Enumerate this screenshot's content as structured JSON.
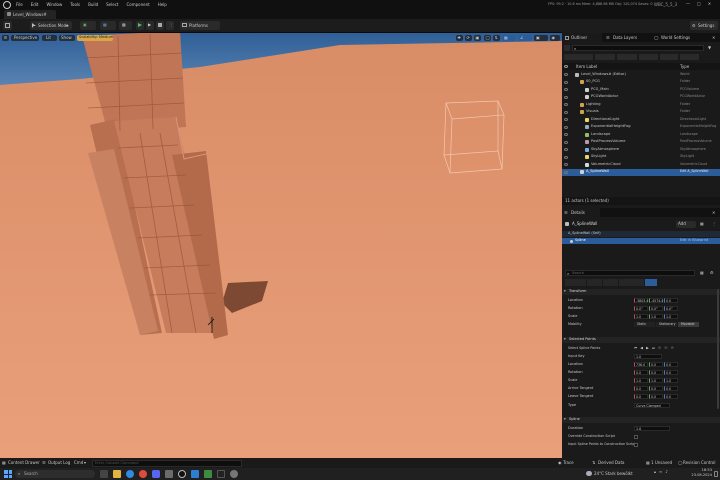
{
  "menubar": {
    "items": [
      "File",
      "Edit",
      "Window",
      "Tools",
      "Build",
      "Select",
      "Component",
      "Help"
    ],
    "stats": "FPS: 99.2 · 10.6 ms   Mem: 4,888.98 MB   Obj: 120,074   Saves: 0",
    "project": "WBC_5_5_3"
  },
  "tab": {
    "label": "Level_Windows#"
  },
  "toolbar": {
    "mode_label": "Selection Mode",
    "platforms_label": "Platforms",
    "settings_label": "Settings"
  },
  "viewport": {
    "perspective_label": "Perspective",
    "lit_label": "Lit",
    "show_label": "Show",
    "badge": "Scalability: Medium"
  },
  "outliner": {
    "tabs": [
      "Outliner",
      "Data Layers",
      "World Settings"
    ],
    "filter_chips": [
      "Directional Light",
      "Landscape",
      "Point Light",
      "Rect Light",
      "Sky Light",
      "Spot Light"
    ],
    "col_label": "Item Label",
    "col_type": "Type",
    "rows": [
      {
        "label": "Level_Windows# (Editor)",
        "type": "World",
        "indent": 1,
        "icon": "world-icon"
      },
      {
        "label": "00_PCG",
        "type": "Folder",
        "indent": 2,
        "icon": "folder-icon"
      },
      {
        "label": "PCG_Main",
        "type": "PCGVolume",
        "indent": 3,
        "icon": "actor-icon"
      },
      {
        "label": "PCGWorldActor",
        "type": "PCGWorldActor",
        "indent": 3,
        "icon": "actor-icon"
      },
      {
        "label": "Lighting",
        "type": "Folder",
        "indent": 2,
        "icon": "folder-icon"
      },
      {
        "label": "Visuals",
        "type": "Folder",
        "indent": 2,
        "icon": "folder-icon"
      },
      {
        "label": "DirectionalLight",
        "type": "DirectionalLight",
        "indent": 3,
        "icon": "light-icon"
      },
      {
        "label": "ExponentialHeightFog",
        "type": "ExponentialHeightFog",
        "indent": 3,
        "icon": "fog-icon"
      },
      {
        "label": "Landscape",
        "type": "Landscape",
        "indent": 3,
        "icon": "landscape-icon"
      },
      {
        "label": "PostProcessVolume",
        "type": "PostProcessVolume",
        "indent": 3,
        "icon": "volume-icon"
      },
      {
        "label": "SkyAtmosphere",
        "type": "SkyAtmosphere",
        "indent": 3,
        "icon": "sky-icon"
      },
      {
        "label": "SkyLight",
        "type": "SkyLight",
        "indent": 3,
        "icon": "light-icon"
      },
      {
        "label": "VolumetricCloud",
        "type": "VolumetricCloud",
        "indent": 3,
        "icon": "cloud-icon"
      },
      {
        "label": "A_SplineWall",
        "type": "Edit A_SplineWall",
        "indent": 2,
        "icon": "actor-icon",
        "selected": true
      }
    ],
    "status": "11 actors (1 selected)"
  },
  "details": {
    "tab": "Details",
    "actor_name": "A_SplineWall",
    "add_label": "Add",
    "components": [
      {
        "label": "A_SplineWall (Self)",
        "right": ""
      },
      {
        "label": "Spline",
        "right": "Edit in Blueprint"
      }
    ],
    "search_placeholder": "Search",
    "filter_tabs": [
      "General",
      "LOD",
      "Misc",
      "Rendering",
      "All"
    ],
    "sections": {
      "transform": "Transform",
      "selected_point": "Selected Points",
      "spline": "Spline"
    },
    "transform": {
      "location": {
        "label": "Location",
        "x": "-3803.4",
        "y": "-4574.4",
        "z": "0.0"
      },
      "rotation": {
        "label": "Rotation",
        "x": "0.0°",
        "y": "0.0°",
        "z": "0.0°"
      },
      "scale": {
        "label": "Scale",
        "x": "1.0",
        "y": "1.0",
        "z": "1.0"
      },
      "mobility": {
        "label": "Mobility",
        "options": [
          "Static",
          "Stationary",
          "Movable"
        ],
        "selected": "Movable"
      }
    },
    "selected_points": {
      "edit_label": "Select Spline Points",
      "input_key": {
        "label": "Input Key",
        "value": "1.0"
      },
      "location": {
        "label": "Location",
        "x": "736.0",
        "y": "0.0",
        "z": "0.0"
      },
      "rotation": {
        "label": "Rotation",
        "x": "0.0",
        "y": "0.0",
        "z": "0.0"
      },
      "scale": {
        "label": "Scale",
        "x": "1.0",
        "y": "1.0",
        "z": "1.0"
      },
      "arrive": {
        "label": "Arrive Tangent",
        "x": "0.0",
        "y": "0.0",
        "z": "0.0"
      },
      "leave": {
        "label": "Leave Tangent",
        "x": "0.0",
        "y": "0.0",
        "z": "0.0"
      },
      "type": {
        "label": "Type",
        "value": "Curve Clamped"
      }
    },
    "spline": {
      "duration": {
        "label": "Duration",
        "value": "1.0"
      },
      "override": {
        "label": "Override Construction Script"
      },
      "input_keys": {
        "label": "Input Spline Points to Construction Script"
      }
    }
  },
  "bottom": {
    "content_drawer": "Content Drawer",
    "output_log": "Output Log",
    "cmd": "Cmd",
    "console_placeholder": "Enter Console Command",
    "trace": "Trace",
    "derived_data": "Derived Data",
    "unsaved": "1 Unsaved",
    "revision": "Revision Control"
  },
  "taskbar": {
    "search_placeholder": "Search",
    "weather": "24°C  Stark bewölkt",
    "time": "18:53",
    "date": "23.08.2024"
  },
  "colors": {
    "accent": "#2a5d9a",
    "sand": "#e69a72",
    "sky": "#3f6fa6"
  }
}
